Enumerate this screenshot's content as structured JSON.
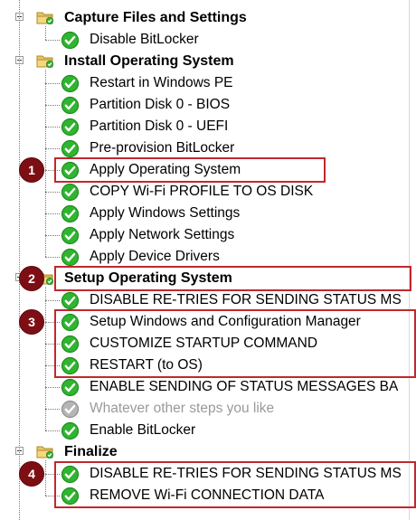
{
  "tree": {
    "groups": [
      {
        "label": "Capture Files and Settings",
        "steps": [
          {
            "label": "Disable BitLocker",
            "status": "ok"
          }
        ]
      },
      {
        "label": "Install Operating System",
        "steps": [
          {
            "label": "Restart in Windows PE",
            "status": "ok"
          },
          {
            "label": "Partition Disk 0 - BIOS",
            "status": "ok"
          },
          {
            "label": "Partition Disk 0 - UEFI",
            "status": "ok"
          },
          {
            "label": "Pre-provision BitLocker",
            "status": "ok"
          },
          {
            "label": "Apply Operating System",
            "status": "ok"
          },
          {
            "label": "COPY Wi-Fi PROFILE TO OS DISK",
            "status": "ok"
          },
          {
            "label": "Apply Windows Settings",
            "status": "ok"
          },
          {
            "label": "Apply Network Settings",
            "status": "ok"
          },
          {
            "label": "Apply Device Drivers",
            "status": "ok"
          }
        ]
      },
      {
        "label": "Setup Operating System",
        "steps": [
          {
            "label": "DISABLE RE-TRIES FOR SENDING STATUS MS",
            "status": "ok"
          },
          {
            "label": "Setup Windows and Configuration Manager",
            "status": "ok"
          },
          {
            "label": "CUSTOMIZE STARTUP COMMAND",
            "status": "ok"
          },
          {
            "label": "RESTART (to OS)",
            "status": "ok"
          },
          {
            "label": "ENABLE SENDING OF STATUS MESSAGES BA",
            "status": "ok"
          },
          {
            "label": "Whatever other steps you like",
            "status": "disabled"
          },
          {
            "label": "Enable BitLocker",
            "status": "ok"
          }
        ]
      },
      {
        "label": "Finalize",
        "steps": [
          {
            "label": "DISABLE RE-TRIES FOR SENDING STATUS MS",
            "status": "ok"
          },
          {
            "label": "REMOVE Wi-Fi CONNECTION DATA",
            "status": "ok"
          }
        ]
      }
    ]
  },
  "callouts": [
    "1",
    "2",
    "3",
    "4"
  ],
  "colors": {
    "check_green": "#2fb52f",
    "check_disabled": "#b5b5b5",
    "highlight_border": "#c0282f",
    "badge_fill": "#7d0f14"
  }
}
